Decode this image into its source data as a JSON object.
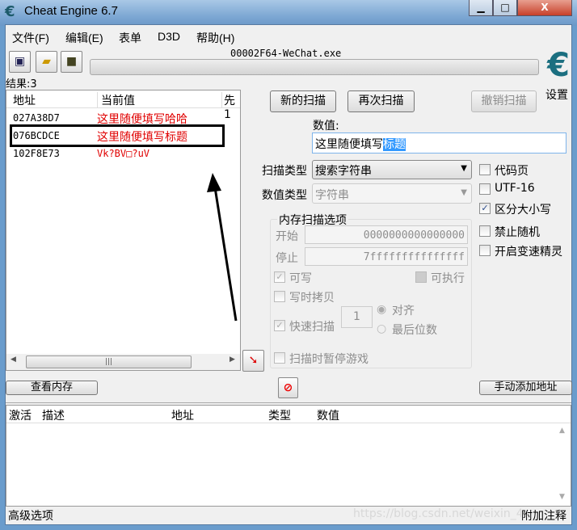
{
  "window": {
    "title": "Cheat Engine 6.7",
    "minimize": "▁",
    "maximize": "□",
    "close": "X"
  },
  "menu": [
    "文件(F)",
    "编辑(E)",
    "表单",
    "D3D",
    "帮助(H)"
  ],
  "process": "00002F64-WeChat.exe",
  "settings_label": "设置",
  "results_label": "结果:3",
  "results": {
    "columns": [
      "地址",
      "当前值",
      "先1"
    ],
    "rows": [
      {
        "address": "027A38D7",
        "value": "这里随便填写哈哈"
      },
      {
        "address": "076BCDCE",
        "value": "这里随便填写标题"
      },
      {
        "address": "102F8E73",
        "value": "Vk?BV□?uV"
      }
    ],
    "value_color": "#e00000"
  },
  "buttons": {
    "new_scan": "新的扫描",
    "next_scan": "再次扫描",
    "undo_scan": "撤销扫描",
    "view_memory": "查看内存",
    "add_address": "手动添加地址"
  },
  "value": {
    "label": "数值:",
    "text": "这里随便填写",
    "selected": "标题"
  },
  "scan_type": {
    "label": "扫描类型",
    "value": "搜索字符串"
  },
  "value_type": {
    "label": "数值类型",
    "value": "字符串"
  },
  "options": [
    {
      "label": "代码页",
      "checked": false
    },
    {
      "label": "UTF-16",
      "checked": false
    },
    {
      "label": "区分大小写",
      "checked": true
    },
    {
      "label": "禁止随机",
      "checked": false
    },
    {
      "label": "开启变速精灵",
      "checked": false
    }
  ],
  "memory": {
    "title": "内存扫描选项",
    "start_label": "开始",
    "start": "0000000000000000",
    "stop_label": "停止",
    "stop": "7fffffffffffffff",
    "writable": "可写",
    "executable": "可执行",
    "copy_on_write": "写时拷贝",
    "fast_scan": "快速扫描",
    "fast_value": "1",
    "align": "对齐",
    "last_digits": "最后位数",
    "pause": "扫描时暂停游戏"
  },
  "table": {
    "columns": [
      "激活",
      "描述",
      "地址",
      "类型",
      "数值"
    ]
  },
  "footer": {
    "advanced": "高级选项",
    "comments": "附加注释",
    "watermark": "https://blog.csdn.net/weixin_4"
  }
}
